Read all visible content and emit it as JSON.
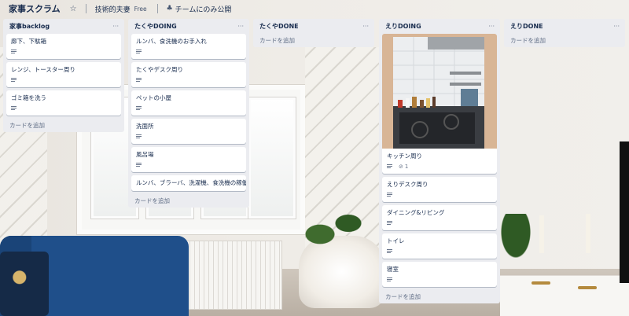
{
  "header": {
    "board_title": "家事スクラム",
    "team_name": "技術的夫妻",
    "plan_badge": "Free",
    "visibility": "チームにのみ公開",
    "icons": {
      "star": "star-icon",
      "team": "team-icon"
    }
  },
  "lists": [
    {
      "title": "家事backlog",
      "menu": "···",
      "cards": [
        {
          "title": "廊下、下駄箱"
        },
        {
          "title": "レンジ、トースター周り"
        },
        {
          "title": "ゴミ箱を洗う"
        }
      ],
      "add_card": "カードを追加"
    },
    {
      "title": "たくやDOING",
      "menu": "···",
      "cards": [
        {
          "title": "ルンバ、食洗機のお手入れ"
        },
        {
          "title": "たくやデスク周り"
        },
        {
          "title": "ペットの小屋"
        },
        {
          "title": "洗面所"
        },
        {
          "title": "風呂場"
        },
        {
          "title": "ルンバ、ブラーバ、洗濯機、食洗機の稼働"
        }
      ],
      "add_card": "カードを追加"
    },
    {
      "title": "たくやDONE",
      "menu": "···",
      "cards": [],
      "add_card": "カードを追加"
    },
    {
      "title": "えりDOING",
      "menu": "···",
      "cards": [
        {
          "title": "キッチン周り",
          "attachments": "1"
        },
        {
          "title": "えりデスク周り"
        },
        {
          "title": "ダイニング&リビング"
        },
        {
          "title": "トイレ"
        },
        {
          "title": "寝室"
        }
      ],
      "add_card": "カードを追加"
    },
    {
      "title": "えりDONE",
      "menu": "···",
      "cards": [],
      "add_card": "カードを追加"
    }
  ],
  "colors": {
    "list_bg": "#ebecf0",
    "card_bg": "#ffffff",
    "text": "#172b4d",
    "muted": "#5e6c84"
  }
}
